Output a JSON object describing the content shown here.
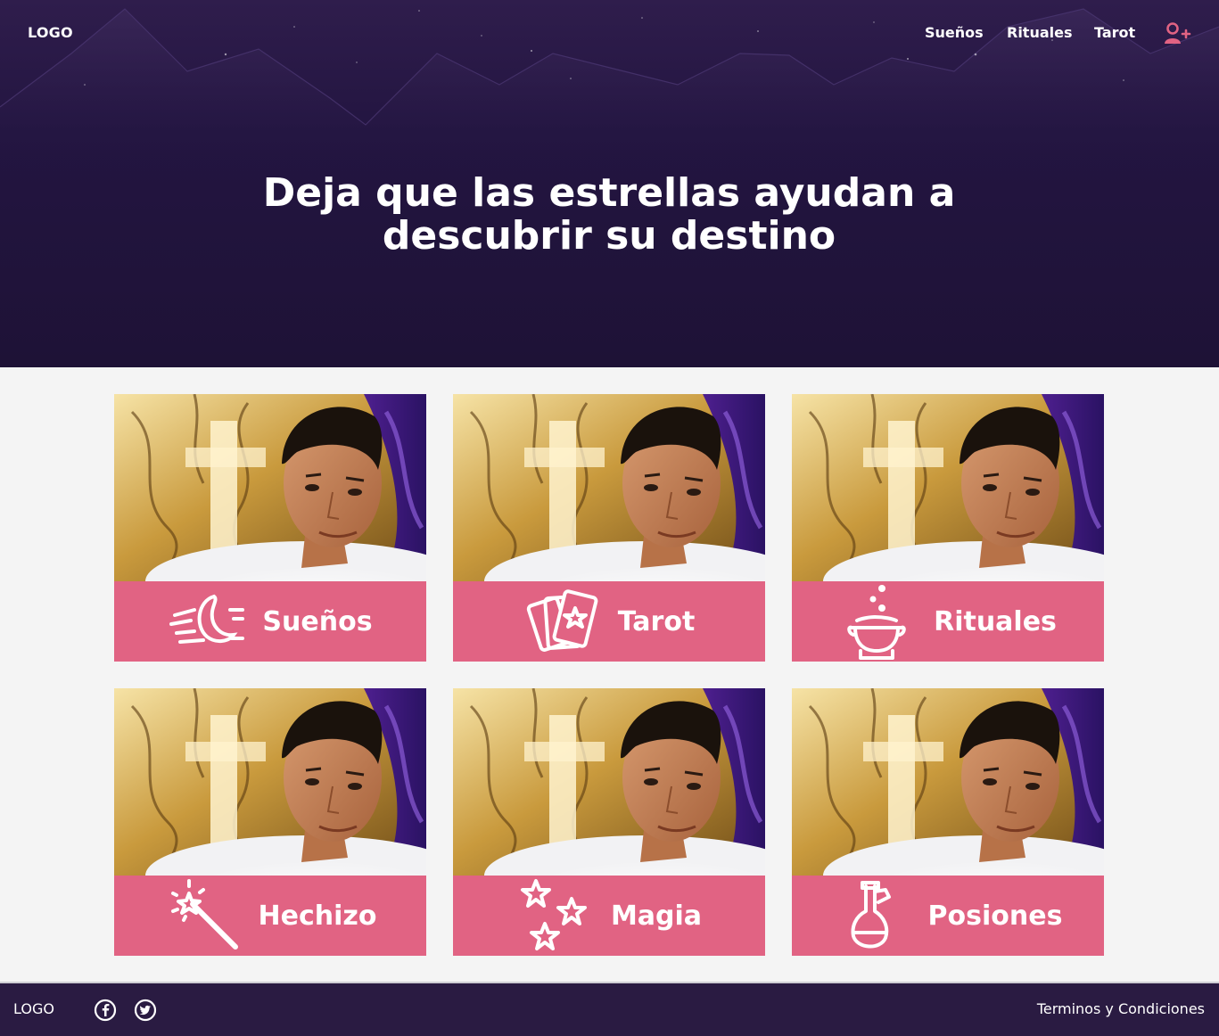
{
  "header": {
    "logo": "LOGO",
    "nav": [
      "Sueños",
      "Rituales",
      "Tarot"
    ],
    "user_icon": "user-plus-icon",
    "user_icon_color": "#e16383"
  },
  "hero": {
    "title_line1": "Deja que las estrellas ayudan a",
    "title_line2": "descubrir su destino",
    "background_color": "#231541"
  },
  "categories": [
    {
      "label": "Sueños",
      "icon": "moon-icon"
    },
    {
      "label": "Tarot",
      "icon": "tarot-cards-icon"
    },
    {
      "label": "Rituales",
      "icon": "cauldron-icon"
    },
    {
      "label": "Hechizo",
      "icon": "magic-wand-icon"
    },
    {
      "label": "Magia",
      "icon": "stars-icon"
    },
    {
      "label": "Posiones",
      "icon": "potion-icon"
    }
  ],
  "colors": {
    "accent": "#e16383",
    "footer": "#2a1b42"
  },
  "footer": {
    "logo": "LOGO",
    "social": [
      "facebook-icon",
      "twitter-icon"
    ],
    "terms": "Terminos y Condiciones"
  }
}
